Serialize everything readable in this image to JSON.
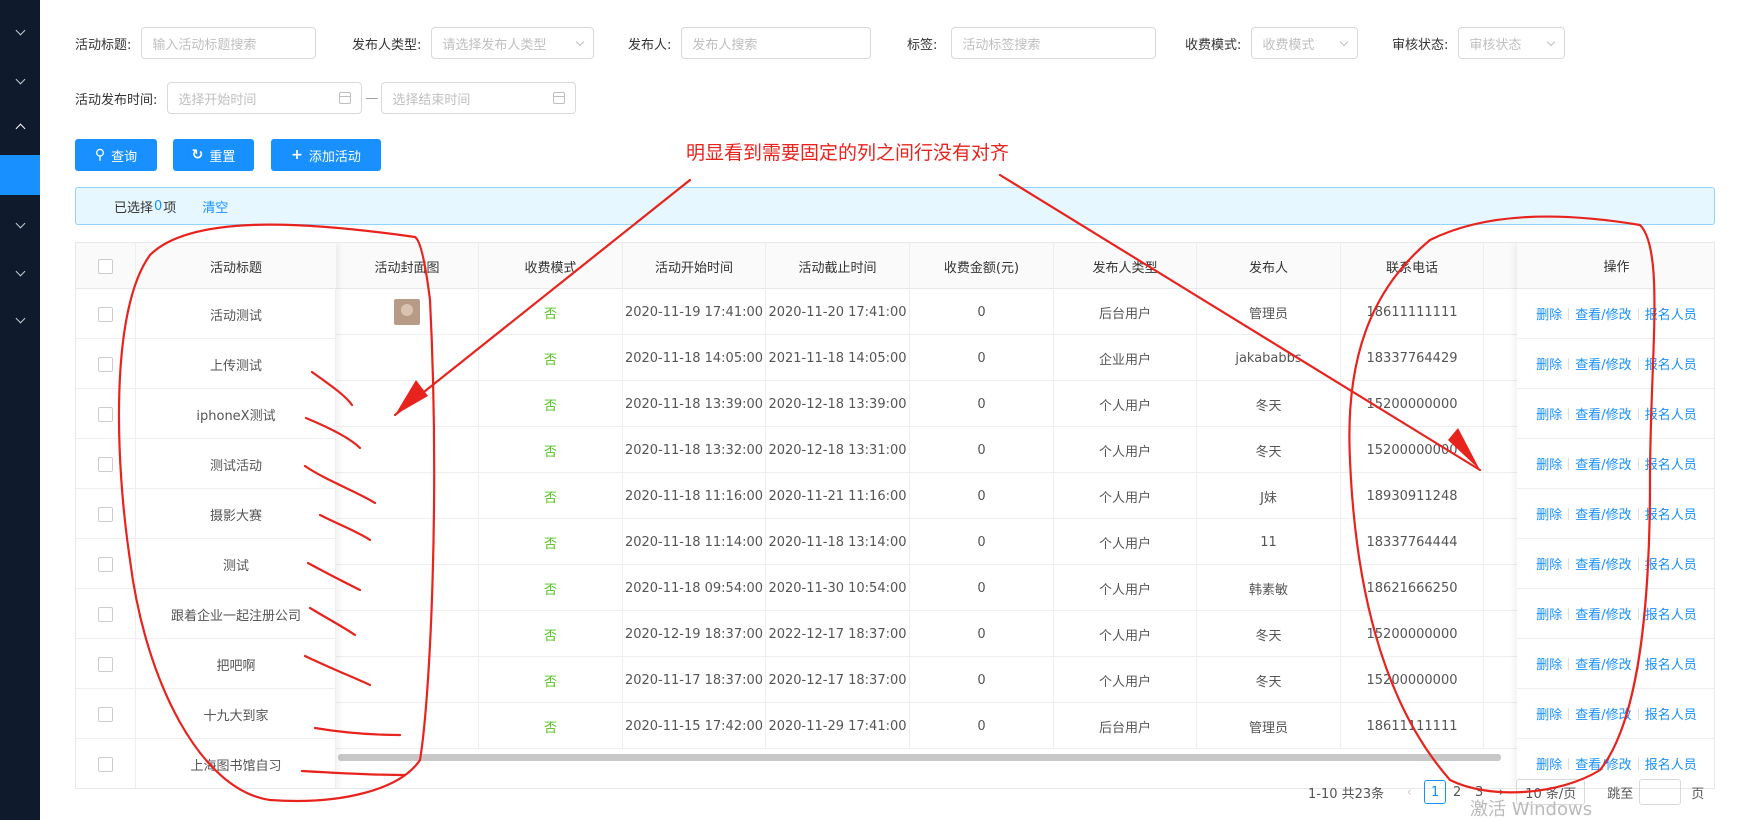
{
  "sidebar": {
    "icons": [
      "chevron-down-icon",
      "chevron-down-icon",
      "chevron-up-icon",
      "",
      "chevron-down-icon",
      "chevron-down-icon",
      "chevron-down-icon"
    ]
  },
  "filters": {
    "title": {
      "label": "活动标题:",
      "placeholder": "输入活动标题搜索"
    },
    "publisher_type": {
      "label": "发布人类型:",
      "placeholder": "请选择发布人类型"
    },
    "publisher": {
      "label": "发布人:",
      "placeholder": "发布人搜索"
    },
    "tag": {
      "label": "标签:",
      "placeholder": "活动标签搜索"
    },
    "fee_mode": {
      "label": "收费模式:",
      "placeholder": "收费模式"
    },
    "review": {
      "label": "审核状态:",
      "placeholder": "审核状态"
    },
    "publish_time": {
      "label": "活动发布时间:",
      "start_placeholder": "选择开始时间",
      "separator": "—",
      "end_placeholder": "选择结束时间"
    }
  },
  "toolbar": {
    "query": "查询",
    "reset": "重置",
    "add": "添加活动"
  },
  "alert": {
    "prefix": "已选择",
    "count": "0",
    "suffix": "项",
    "clear": "清空"
  },
  "table": {
    "headers": {
      "title": "活动标题",
      "cover": "活动封面图",
      "fee_mode": "收费模式",
      "start": "活动开始时间",
      "end": "活动截止时间",
      "amount": "收费金额(元)",
      "publisher_type": "发布人类型",
      "publisher": "发布人",
      "phone": "联系电话",
      "ops": "操作"
    },
    "rows": [
      {
        "title": "活动测试",
        "fee": "否",
        "start": "2020-11-19 17:41:00",
        "end": "2020-11-20 17:41:00",
        "amount": "0",
        "ptype": "后台用户",
        "publisher": "管理员",
        "phone": "18611111111",
        "extra": ""
      },
      {
        "title": "上传测试",
        "fee": "否",
        "start": "2020-11-18 14:05:00",
        "end": "2021-11-18 14:05:00",
        "amount": "0",
        "ptype": "企业用户",
        "publisher": "jakababbs",
        "phone": "18337764429",
        "extra": ""
      },
      {
        "title": "iphoneX测试",
        "fee": "否",
        "start": "2020-11-18 13:39:00",
        "end": "2020-12-18 13:39:00",
        "amount": "0",
        "ptype": "个人用户",
        "publisher": "冬天",
        "phone": "15200000000",
        "extra": ""
      },
      {
        "title": "测试活动",
        "fee": "否",
        "start": "2020-11-18 13:32:00",
        "end": "2020-12-18 13:31:00",
        "amount": "0",
        "ptype": "个人用户",
        "publisher": "冬天",
        "phone": "15200000000",
        "extra": ""
      },
      {
        "title": "摄影大赛",
        "fee": "否",
        "start": "2020-11-18 11:16:00",
        "end": "2020-11-21 11:16:00",
        "amount": "0",
        "ptype": "个人用户",
        "publisher": "J妹",
        "phone": "18930911248",
        "extra": ""
      },
      {
        "title": "测试",
        "fee": "否",
        "start": "2020-11-18 11:14:00",
        "end": "2020-11-18 13:14:00",
        "amount": "0",
        "ptype": "个人用户",
        "publisher": "11",
        "phone": "18337764444",
        "extra": ""
      },
      {
        "title": "跟着企业一起注册公司",
        "fee": "否",
        "start": "2020-11-18 09:54:00",
        "end": "2020-11-30 10:54:00",
        "amount": "0",
        "ptype": "个人用户",
        "publisher": "韩素敏",
        "phone": "18621666250",
        "extra": ""
      },
      {
        "title": "把吧啊",
        "fee": "否",
        "start": "2020-12-19 18:37:00",
        "end": "2022-12-17 18:37:00",
        "amount": "0",
        "ptype": "个人用户",
        "publisher": "冬天",
        "phone": "15200000000",
        "extra": ""
      },
      {
        "title": "十九大到家",
        "fee": "否",
        "start": "2020-11-17 18:37:00",
        "end": "2020-12-17 18:37:00",
        "amount": "0",
        "ptype": "个人用户",
        "publisher": "冬天",
        "phone": "15200000000",
        "extra": ""
      },
      {
        "title": "上海图书馆自习",
        "fee": "否",
        "start": "2020-11-15 17:42:00",
        "end": "2020-11-29 17:41:00",
        "amount": "0",
        "ptype": "后台用户",
        "publisher": "管理员",
        "phone": "18611111111",
        "extra": "上海"
      }
    ],
    "ops": {
      "delete": "删除",
      "view": "查看/修改",
      "signups": "报名人员"
    }
  },
  "pagination": {
    "summary": "1-10 共23条",
    "prev": "‹",
    "pages": [
      "1",
      "2",
      "3"
    ],
    "next": "›",
    "page_size": "10 条/页",
    "jump_label": "跳至",
    "jump_suffix": "页"
  },
  "annotation": {
    "text": "明显看到需要固定的列之间行没有对齐",
    "color": "#e8231e"
  },
  "watermark": "激活 Windows"
}
